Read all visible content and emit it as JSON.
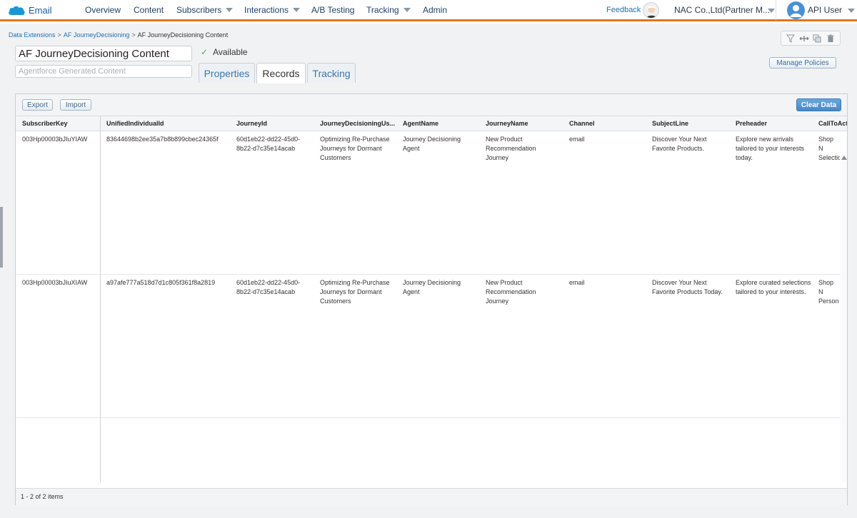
{
  "app": {
    "brand": "Email",
    "nav": [
      "Overview",
      "Content",
      "Subscribers",
      "Interactions",
      "A/B Testing",
      "Tracking",
      "Admin"
    ],
    "feedback": "Feedback",
    "org_name": "NAC Co.,Ltd(Partner M...",
    "user_name": "API User"
  },
  "breadcrumb": {
    "item1": "Data Extensions",
    "item2": "AF JourneyDecisioning",
    "current": "AF JourneyDecisioning Content",
    "separator": ">"
  },
  "header": {
    "title": "AF JourneyDecisioning Content",
    "description_placeholder": "Agentforce Generated Content",
    "status": "Available",
    "manage_policies": "Manage Policies"
  },
  "tabs": [
    "Properties",
    "Records",
    "Tracking"
  ],
  "active_tab": "Records",
  "toolbar": {
    "export": "Export",
    "import": "Import",
    "clear_data": "Clear Data"
  },
  "table": {
    "columns": [
      "SubscriberKey",
      "UnifiedIndividualId",
      "JourneyId",
      "JourneyDecisioningUs...",
      "AgentName",
      "JourneyName",
      "Channel",
      "SubjectLine",
      "Preheader",
      "CallToAct"
    ],
    "rows": [
      {
        "SubscriberKey": "003Hp00003bJIuYIAW",
        "UnifiedIndividualId": "83644698b2ee35a7b8b899cbec24365f",
        "JourneyId": "60d1eb22-dd22-45d0-8b22-d7c35e14acab",
        "JourneyDecisioningUs": "Optimizing Re-Purchase Journeys for Dormant Customers",
        "AgentName": "Journey Decisioning Agent",
        "JourneyName": "New Product Recommendation Journey",
        "Channel": "email",
        "SubjectLine": "Discover Your Next Favorite Products.",
        "Preheader": "Explore new arrivals tailored to your interests today.",
        "CallToAct": "Shop N Selectio"
      },
      {
        "SubscriberKey": "003Hp00003bJIuXIAW",
        "UnifiedIndividualId": "a97afe777a518d7d1c805f361f8a2819",
        "JourneyId": "60d1eb22-dd22-45d0-8b22-d7c35e14acab",
        "JourneyDecisioningUs": "Optimizing Re-Purchase Journeys for Dormant Customers",
        "AgentName": "Journey Decisioning Agent",
        "JourneyName": "New Product Recommendation Journey",
        "Channel": "email",
        "SubjectLine": "Discover Your Next Favorite Products Today.",
        "Preheader": "Explore curated selections tailored to your interests.",
        "CallToAct": "Shop N Person"
      }
    ],
    "footer": "1 - 2 of 2 items"
  },
  "icons": {
    "brand": "salesforce-cloud-icon",
    "toolbar": [
      "filter-icon",
      "columns-icon",
      "copy-icon",
      "trash-icon"
    ]
  },
  "colors": {
    "accent": "#e5731e",
    "link": "#1f6fb2",
    "primary_button": "#4688c7",
    "available": "#4caf50"
  }
}
